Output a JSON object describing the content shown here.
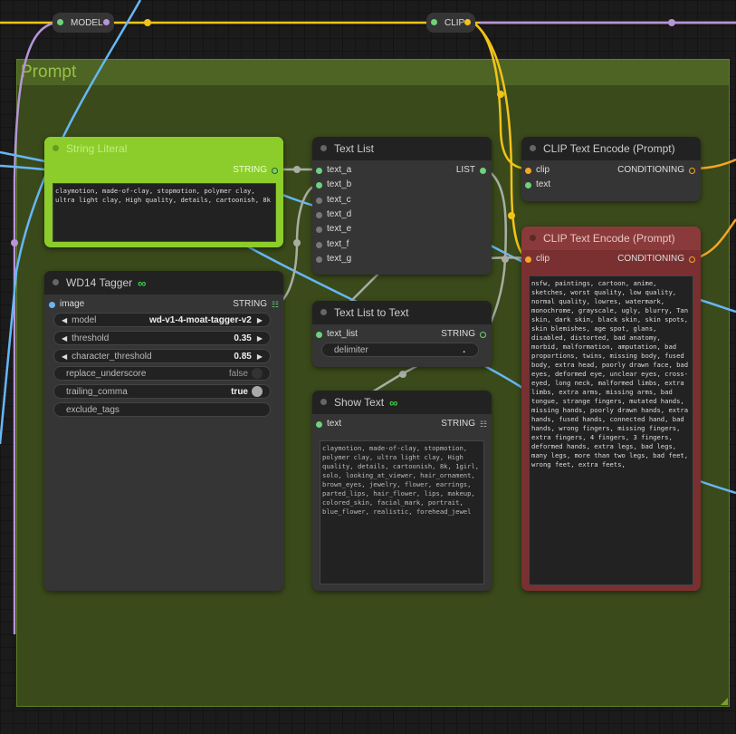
{
  "colors": {
    "background": "#1b1b1b",
    "group_fill": "#3a4a1b",
    "group_header": "#4d6424",
    "accent_green": "#8ccd2b",
    "clip_node_red": "#8a3a3a",
    "wire_yellow": "#f2c318",
    "wire_blue": "#67b7f5",
    "wire_purple": "#b695d9",
    "wire_gray": "#a8aea4",
    "wire_orange": "#f5a623"
  },
  "group": {
    "title": "Prompt"
  },
  "reroutes": [
    {
      "label": "MODEL"
    },
    {
      "label": "CLIP"
    }
  ],
  "string_literal": {
    "title": "String Literal",
    "output": "STRING",
    "text": "claymotion, made-of-clay, stopmotion, polymer clay, ultra light clay, High quality, details, cartoonish, 8k"
  },
  "wd14": {
    "title": "WD14 Tagger",
    "title_icon": "link-icon",
    "input": "image",
    "output": "STRING",
    "widgets": [
      {
        "label": "model",
        "value": "wd-v1-4-moat-tagger-v2",
        "kind": "combo"
      },
      {
        "label": "threshold",
        "value": "0.35",
        "kind": "number"
      },
      {
        "label": "character_threshold",
        "value": "0.85",
        "kind": "number"
      },
      {
        "label": "replace_underscore",
        "value": "false",
        "kind": "toggle"
      },
      {
        "label": "trailing_comma",
        "value": "true",
        "kind": "toggle"
      },
      {
        "label": "exclude_tags",
        "value": "",
        "kind": "text"
      }
    ]
  },
  "text_list": {
    "title": "Text List",
    "inputs": [
      "text_a",
      "text_b",
      "text_c",
      "text_d",
      "text_e",
      "text_f",
      "text_g"
    ],
    "output": "LIST"
  },
  "text_list_to_text": {
    "title": "Text List to Text",
    "input": "text_list",
    "output": "STRING",
    "delimiter_label": "delimiter",
    "delimiter_value": "."
  },
  "show_text": {
    "title": "Show Text",
    "input": "text",
    "output": "STRING",
    "content": "claymotion, made-of-clay, stopmotion, polymer clay, ultra light clay, High quality, details, cartoonish, 8k, 1girl, solo, looking_at_viewer, hair_ornament, brown_eyes, jewelry, flower, earrings, parted_lips, hair_flower, lips, makeup, colored_skin, facial_mark, portrait, blue_flower, realistic, forehead_jewel"
  },
  "clip_pos": {
    "title": "CLIP Text Encode (Prompt)",
    "inputs": [
      "clip",
      "text"
    ],
    "output": "CONDITIONING"
  },
  "clip_neg": {
    "title": "CLIP Text Encode (Prompt)",
    "input": "clip",
    "output": "CONDITIONING",
    "text": "nsfw, paintings, cartoon, anime, sketches, worst quality, low quality, normal quality, lowres, watermark, monochrome, grayscale, ugly, blurry, Tan skin, dark skin, black skin, skin spots, skin blemishes, age spot, glans, disabled, distorted, bad anatomy, morbid, malformation, amputation, bad proportions, twins, missing body, fused body, extra head, poorly drawn face, bad eyes, deformed eye, unclear eyes, cross-eyed, long neck, malformed limbs, extra limbs, extra arms, missing arms, bad tongue, strange fingers, mutated hands, missing hands, poorly drawn hands, extra hands, fused hands, connected hand, bad hands, wrong fingers, missing fingers, extra fingers, 4 fingers, 3 fingers, deformed hands, extra legs, bad legs, many legs, more than two legs, bad feet, wrong feet, extra feets,"
  }
}
